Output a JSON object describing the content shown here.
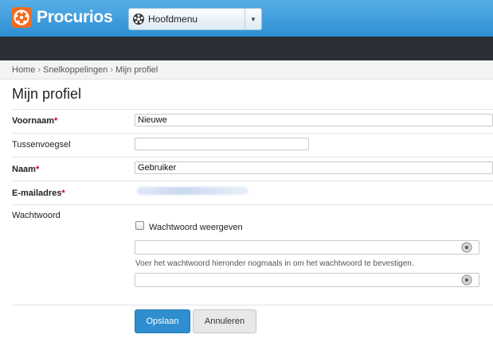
{
  "header": {
    "logo_text": "Procurios",
    "menu_label": "Hoofdmenu"
  },
  "breadcrumb": {
    "items": [
      "Home",
      "Snelkoppelingen",
      "Mijn profiel"
    ],
    "separator": "›"
  },
  "page": {
    "title": "Mijn profiel"
  },
  "form": {
    "first_name": {
      "label": "Voornaam",
      "required_mark": "*",
      "value": "Nieuwe"
    },
    "infix": {
      "label": "Tussenvoegsel",
      "value": ""
    },
    "last_name": {
      "label": "Naam",
      "required_mark": "*",
      "value": "Gebruiker"
    },
    "email": {
      "label": "E-mailadres",
      "required_mark": "*"
    },
    "password": {
      "label": "Wachtwoord",
      "show_label": "Wachtwoord weergeven",
      "confirm_hint": "Voer het wachtwoord hieronder nogmaals in om het wachtwoord te bevestigen."
    }
  },
  "buttons": {
    "save": "Opslaan",
    "cancel": "Annuleren"
  },
  "colors": {
    "header_blue": "#3a9bdc",
    "logo_orange": "#f26b21",
    "primary_button": "#2e8ecf",
    "required_red": "#d0021b"
  },
  "icons": {
    "logo": "procurios-logo-icon",
    "menu": "main-menu-icon",
    "password_toggle": "password-eye-icon"
  }
}
